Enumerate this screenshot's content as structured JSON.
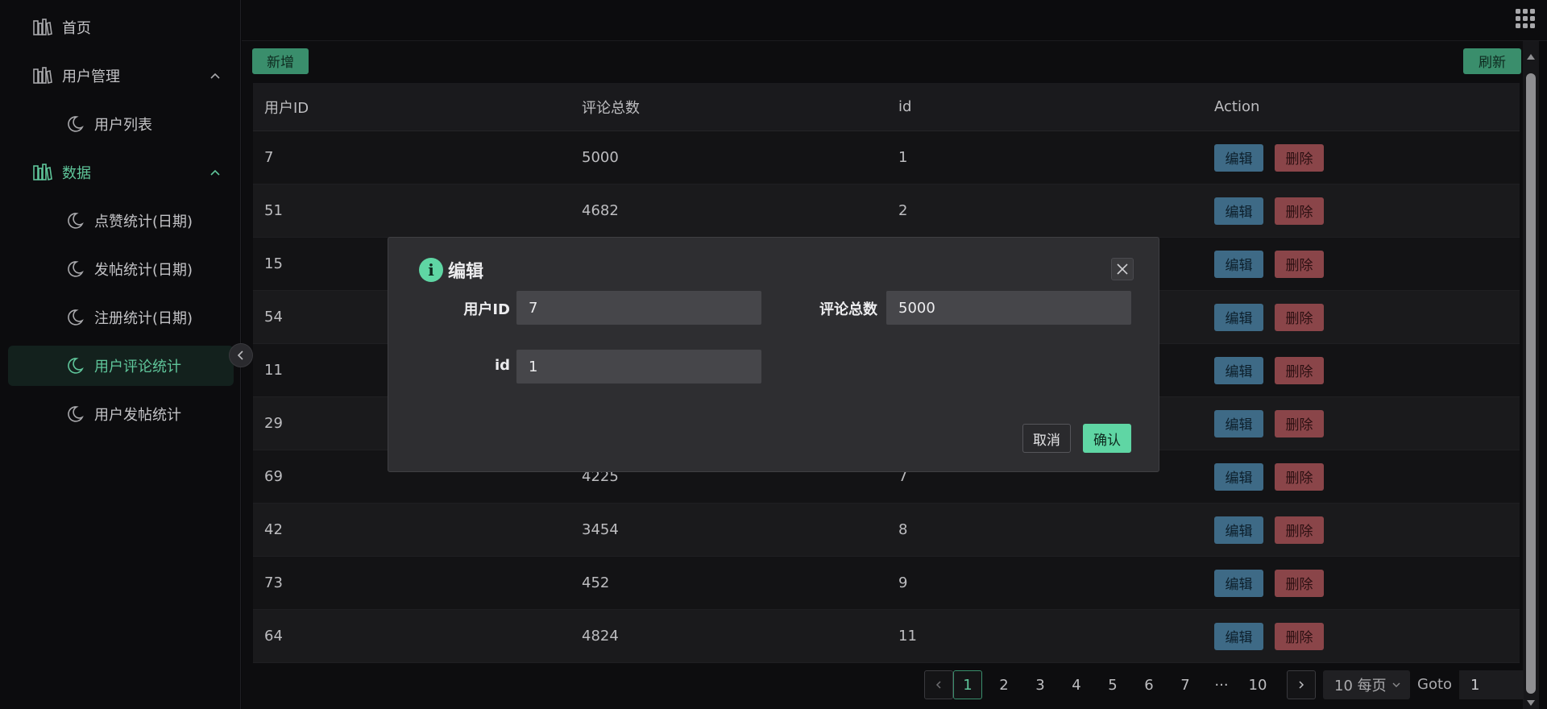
{
  "sidebar": {
    "items": [
      {
        "label": "首页",
        "type": "top"
      },
      {
        "label": "用户管理",
        "type": "group"
      },
      {
        "label": "用户列表",
        "type": "sub"
      },
      {
        "label": "数据",
        "type": "group",
        "active": true
      },
      {
        "label": "点赞统计(日期)",
        "type": "sub"
      },
      {
        "label": "发帖统计(日期)",
        "type": "sub"
      },
      {
        "label": "注册统计(日期)",
        "type": "sub"
      },
      {
        "label": "用户评论统计",
        "type": "sub",
        "selected": true
      },
      {
        "label": "用户发帖统计",
        "type": "sub"
      }
    ]
  },
  "toolbar": {
    "add_label": "新增",
    "refresh_label": "刷新"
  },
  "table": {
    "headers": [
      "用户ID",
      "评论总数",
      "id",
      "Action"
    ],
    "rows": [
      [
        "7",
        "5000",
        "1"
      ],
      [
        "51",
        "4682",
        "2"
      ],
      [
        "15",
        "",
        ""
      ],
      [
        "54",
        "",
        ""
      ],
      [
        "11",
        "",
        ""
      ],
      [
        "29",
        "",
        ""
      ],
      [
        "69",
        "4225",
        "7"
      ],
      [
        "42",
        "3454",
        "8"
      ],
      [
        "73",
        "452",
        "9"
      ],
      [
        "64",
        "4824",
        "11"
      ]
    ],
    "edit_label": "编辑",
    "delete_label": "删除"
  },
  "pagination": {
    "pages": [
      "1",
      "2",
      "3",
      "4",
      "5",
      "6",
      "7",
      "···",
      "10"
    ],
    "current": "1",
    "page_size": "10 每页",
    "goto_label": "Goto",
    "goto_value": "1"
  },
  "modal": {
    "title": "编辑",
    "info_glyph": "i",
    "fields": {
      "user_id_label": "用户ID",
      "user_id_value": "7",
      "comments_label": "评论总数",
      "comments_value": "5000",
      "id_label": "id",
      "id_value": "1"
    },
    "cancel_label": "取消",
    "ok_label": "确认"
  },
  "colors": {
    "accent": "#5fc59a",
    "primary_button": "#3a8e6c",
    "edit_button": "#3e6a86",
    "delete_button": "#8a4549",
    "modal_ok": "#5fd6a4"
  }
}
